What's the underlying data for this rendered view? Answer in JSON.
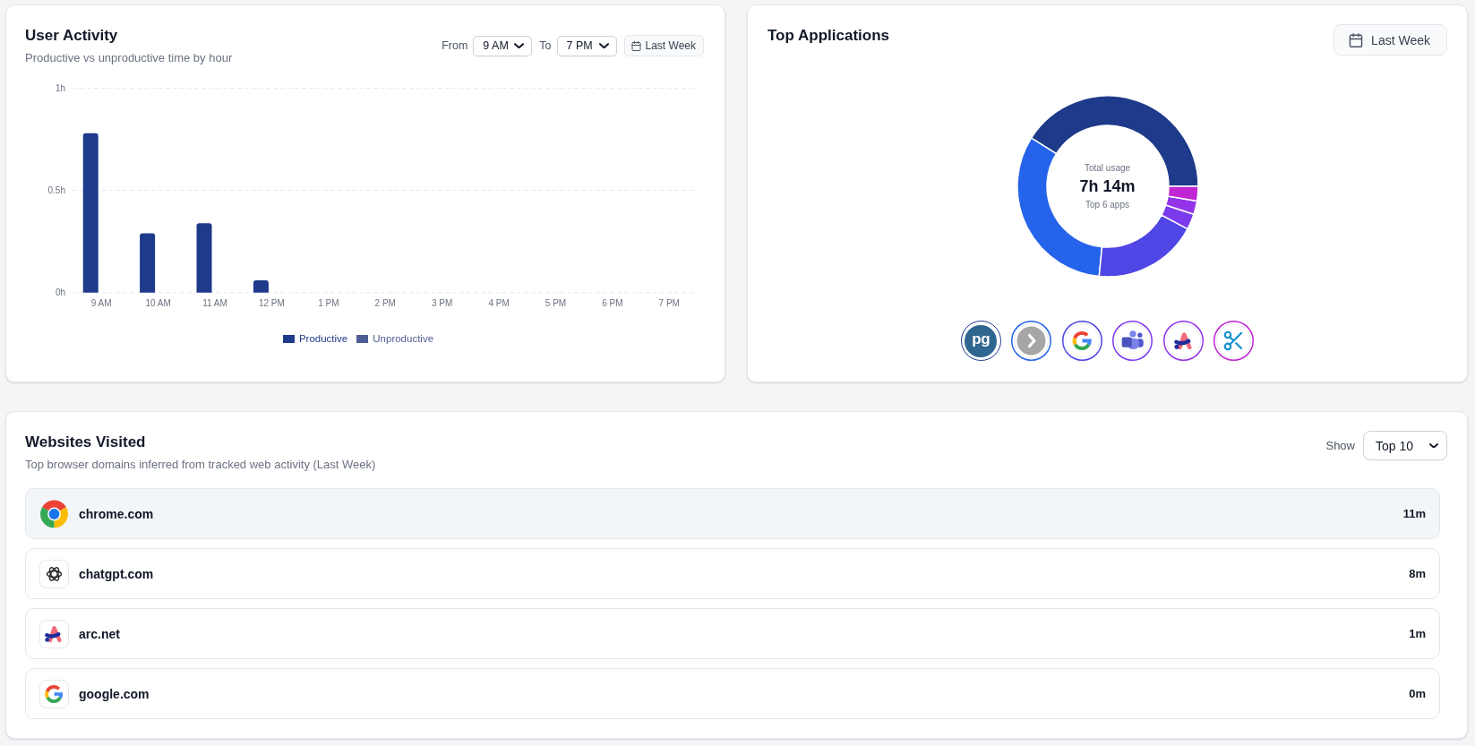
{
  "user_activity": {
    "title": "User Activity",
    "subtitle": "Productive vs unproductive time by hour",
    "from_label": "From",
    "from_value": "9 AM",
    "to_label": "To",
    "to_value": "7 PM",
    "range_button": "Last Week",
    "chart_data": {
      "type": "bar",
      "categories": [
        "9 AM",
        "10 AM",
        "11 AM",
        "12 PM",
        "1 PM",
        "2 PM",
        "3 PM",
        "4 PM",
        "5 PM",
        "6 PM",
        "7 PM"
      ],
      "series": [
        {
          "name": "Productive",
          "color": "#1e3a8a",
          "values": [
            0.78,
            0.29,
            0.34,
            0.06,
            0,
            0,
            0,
            0,
            0,
            0,
            0
          ]
        },
        {
          "name": "Unproductive",
          "color": "#4e5d94",
          "values": [
            0,
            0,
            0,
            0,
            0,
            0,
            0,
            0,
            0,
            0,
            0
          ]
        }
      ],
      "ylim": [
        0,
        1
      ],
      "yticks": [
        {
          "value": 0,
          "label": "0h"
        },
        {
          "value": 0.5,
          "label": "0.5h"
        },
        {
          "value": 1,
          "label": "1h"
        }
      ]
    }
  },
  "top_applications": {
    "title": "Top Applications",
    "range_button": "Last Week",
    "total_label": "Total usage",
    "total_value": "7h 14m",
    "total_caption": "Top 6 apps",
    "apps": [
      {
        "color": "#1e3a8a",
        "logo_text": "pg"
      },
      {
        "color": "#2563eb"
      },
      {
        "color": "#4f46e5"
      },
      {
        "color": "#7c3aed"
      },
      {
        "color": "#9333ea"
      },
      {
        "color": "#c026d3"
      }
    ]
  },
  "websites": {
    "title": "Websites Visited",
    "subtitle": "Top browser domains inferred from tracked web activity (Last Week)",
    "show_label": "Show",
    "show_value": "Top 10",
    "rows": [
      {
        "domain": "chrome.com",
        "time": "11m",
        "highlighted": true
      },
      {
        "domain": "chatgpt.com",
        "time": "8m",
        "highlighted": false
      },
      {
        "domain": "arc.net",
        "time": "1m",
        "highlighted": false
      },
      {
        "domain": "google.com",
        "time": "0m",
        "highlighted": false
      }
    ]
  }
}
